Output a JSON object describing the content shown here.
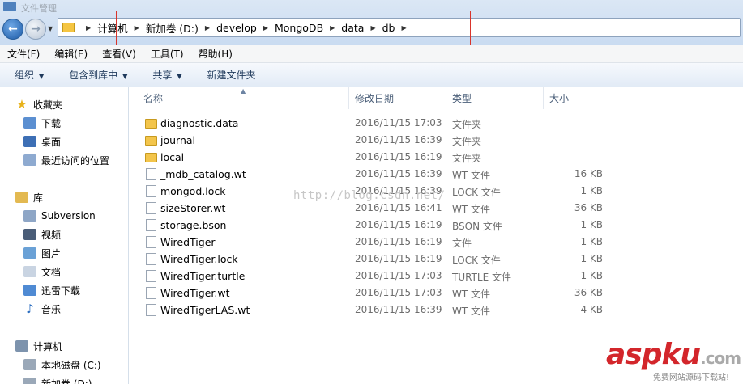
{
  "window": {
    "title": "文件管理"
  },
  "address": {
    "crumbs": [
      "计算机",
      "新加卷 (D:)",
      "develop",
      "MongoDB",
      "data",
      "db"
    ]
  },
  "menu": [
    "文件(F)",
    "编辑(E)",
    "查看(V)",
    "工具(T)",
    "帮助(H)"
  ],
  "toolbar": {
    "organize": "组织",
    "include": "包含到库中",
    "share": "共享",
    "new_folder": "新建文件夹"
  },
  "sidebar": {
    "favorites": "收藏夹",
    "downloads": "下载",
    "desktop": "桌面",
    "recent": "最近访问的位置",
    "libraries": "库",
    "subversion": "Subversion",
    "videos": "视频",
    "pictures": "图片",
    "documents": "文档",
    "thunder": "迅雷下载",
    "music": "音乐",
    "computer": "计算机",
    "local_c": "本地磁盘 (C:)",
    "new_d": "新加卷 (D:)"
  },
  "columns": {
    "name": "名称",
    "date": "修改日期",
    "type": "类型",
    "size": "大小"
  },
  "files": [
    {
      "name": "diagnostic.data",
      "date": "2016/11/15 17:03",
      "type": "文件夹",
      "size": "",
      "folder": true
    },
    {
      "name": "journal",
      "date": "2016/11/15 16:39",
      "type": "文件夹",
      "size": "",
      "folder": true
    },
    {
      "name": "local",
      "date": "2016/11/15 16:19",
      "type": "文件夹",
      "size": "",
      "folder": true
    },
    {
      "name": "_mdb_catalog.wt",
      "date": "2016/11/15 16:39",
      "type": "WT 文件",
      "size": "16 KB",
      "folder": false
    },
    {
      "name": "mongod.lock",
      "date": "2016/11/15 16:39",
      "type": "LOCK 文件",
      "size": "1 KB",
      "folder": false
    },
    {
      "name": "sizeStorer.wt",
      "date": "2016/11/15 16:41",
      "type": "WT 文件",
      "size": "36 KB",
      "folder": false
    },
    {
      "name": "storage.bson",
      "date": "2016/11/15 16:19",
      "type": "BSON 文件",
      "size": "1 KB",
      "folder": false
    },
    {
      "name": "WiredTiger",
      "date": "2016/11/15 16:19",
      "type": "文件",
      "size": "1 KB",
      "folder": false
    },
    {
      "name": "WiredTiger.lock",
      "date": "2016/11/15 16:19",
      "type": "LOCK 文件",
      "size": "1 KB",
      "folder": false
    },
    {
      "name": "WiredTiger.turtle",
      "date": "2016/11/15 17:03",
      "type": "TURTLE 文件",
      "size": "1 KB",
      "folder": false
    },
    {
      "name": "WiredTiger.wt",
      "date": "2016/11/15 17:03",
      "type": "WT 文件",
      "size": "36 KB",
      "folder": false
    },
    {
      "name": "WiredTigerLAS.wt",
      "date": "2016/11/15 16:39",
      "type": "WT 文件",
      "size": "4 KB",
      "folder": false
    }
  ],
  "watermark": "http://blog.csdn.net/",
  "logo": {
    "asp": "asp",
    "ku": "ku",
    "com": ".com",
    "sub": "免费网站源码下载站!"
  },
  "colors": {
    "accent": "#1e395b",
    "logo_red": "#d3262b",
    "folder": "#f3c54b"
  }
}
